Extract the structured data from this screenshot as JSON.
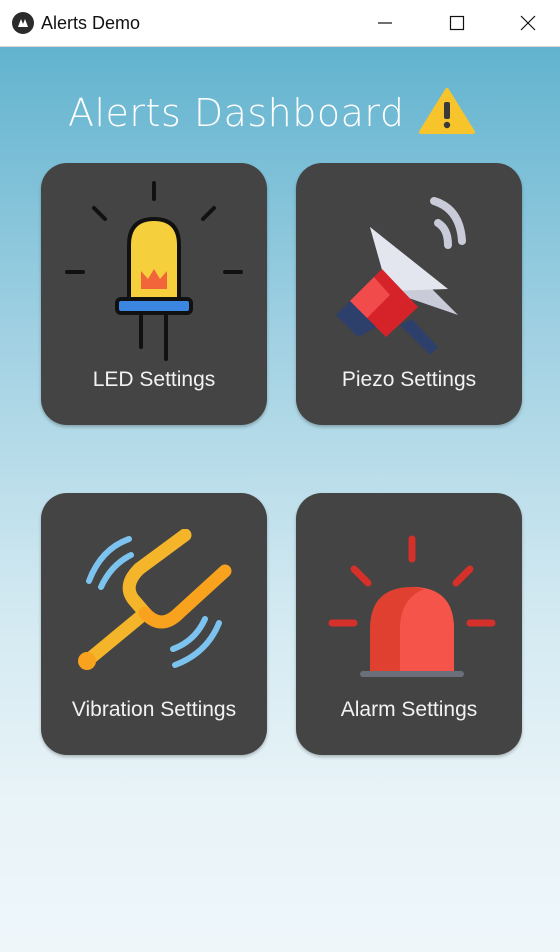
{
  "window": {
    "title": "Alerts Demo"
  },
  "header": {
    "title": "Alerts Dashboard"
  },
  "cards": [
    {
      "label": "LED Settings"
    },
    {
      "label": "Piezo Settings"
    },
    {
      "label": "Vibration Settings"
    },
    {
      "label": "Alarm Settings"
    }
  ],
  "icons": {
    "app": "kivy-icon",
    "warning": "warning-icon",
    "led": "led-bulb-icon",
    "piezo": "megaphone-icon",
    "vibration": "tuning-fork-icon",
    "alarm": "siren-icon"
  },
  "colors": {
    "card_bg": "#444444",
    "gradient_top": "#62b3cf",
    "gradient_bottom": "#eef6fa",
    "warning_yellow": "#f7c52b",
    "alarm_red": "#e0402f"
  }
}
